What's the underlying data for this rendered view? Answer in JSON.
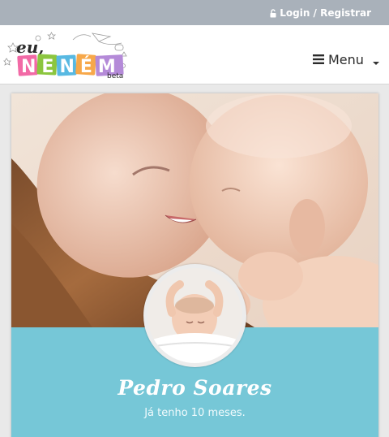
{
  "topbar": {
    "login_label": "Login / Registrar",
    "icon": "lock-icon"
  },
  "header": {
    "logo": {
      "line1": "eu,",
      "line2": "NENÉM",
      "tag": "beta"
    },
    "menu_label": "Menu",
    "menu_icon": "bars-icon"
  },
  "profile": {
    "name": "Pedro Soares",
    "age_text": "Já tenho 10 meses."
  },
  "colors": {
    "topbar": "#a9b1ba",
    "band": "#76c7d7",
    "logo_pink": "#f26aa6",
    "logo_green": "#8cc63f",
    "logo_blue": "#58b9e2",
    "logo_orange": "#f7a84a"
  }
}
